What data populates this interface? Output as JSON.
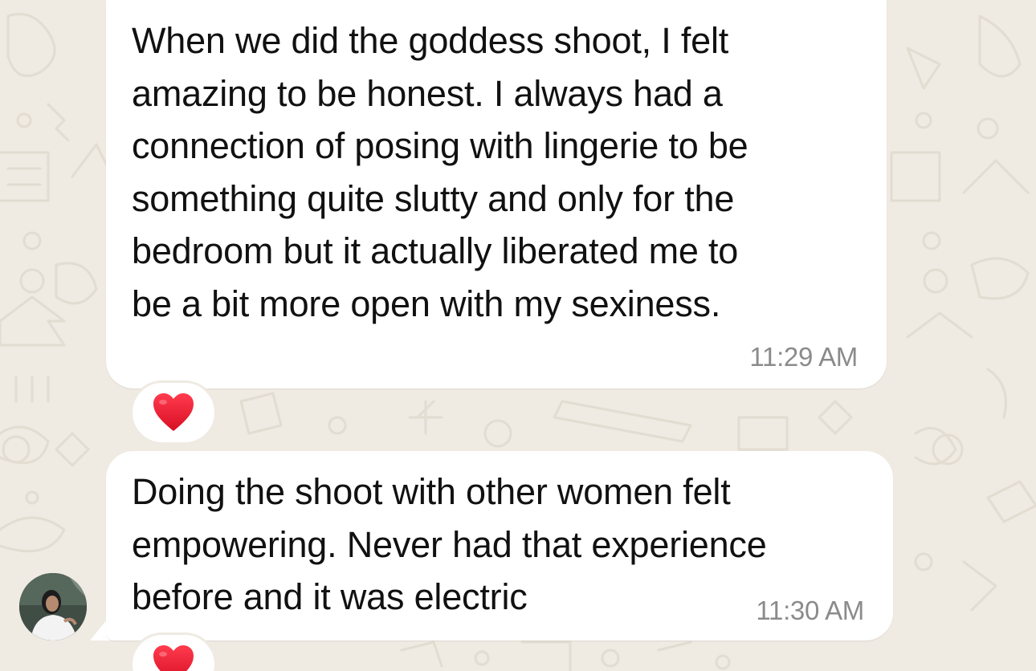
{
  "chat": {
    "messages": [
      {
        "text": "When we did the goddess shoot, I felt\namazing to be honest. I always had a\nconnection of posing with lingerie to be\nsomething quite slutty and only for the\nbedroom but it actually liberated me to\nbe a bit more open with my sexiness.",
        "time": "11:29 AM",
        "reaction": "heart"
      },
      {
        "text": "Doing the shoot with other women felt\nempowering. Never had that experience\nbefore and it was electric",
        "time": "11:30 AM",
        "reaction": "heart"
      }
    ]
  },
  "colors": {
    "wallpaper": "#efeae2",
    "bubble": "#ffffff",
    "heart": "#e8112d"
  }
}
